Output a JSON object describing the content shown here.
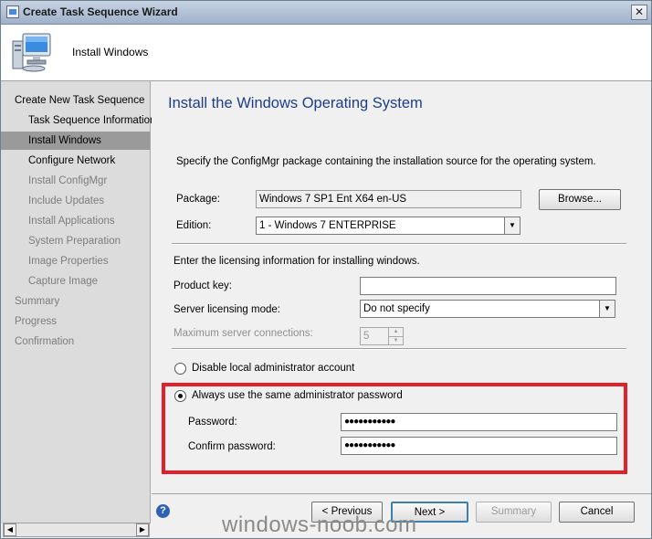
{
  "window": {
    "title": "Create Task Sequence Wizard",
    "close_label": "✕"
  },
  "header": {
    "title": "Install Windows",
    "icon": "computer-icon"
  },
  "nav": {
    "items": [
      {
        "label": "Create New Task Sequence",
        "state": "normal"
      },
      {
        "label": "Task Sequence Information",
        "state": "normal"
      },
      {
        "label": "Install Windows",
        "state": "active"
      },
      {
        "label": "Configure Network",
        "state": "normal"
      },
      {
        "label": "Install ConfigMgr",
        "state": "disabled"
      },
      {
        "label": "Include Updates",
        "state": "disabled"
      },
      {
        "label": "Install Applications",
        "state": "disabled"
      },
      {
        "label": "System Preparation",
        "state": "disabled"
      },
      {
        "label": "Image Properties",
        "state": "disabled"
      },
      {
        "label": "Capture Image",
        "state": "disabled"
      },
      {
        "label": "Summary",
        "state": "disabled"
      },
      {
        "label": "Progress",
        "state": "disabled"
      },
      {
        "label": "Confirmation",
        "state": "disabled"
      }
    ]
  },
  "page": {
    "title": "Install the Windows Operating System",
    "intro": "Specify the ConfigMgr package containing the installation source for the operating system.",
    "package_label": "Package:",
    "package_value": "Windows 7 SP1 Ent X64 en-US",
    "browse_label": "Browse...",
    "edition_label": "Edition:",
    "edition_value": "1 - Windows 7 ENTERPRISE",
    "licensing_text": "Enter the licensing information for installing windows.",
    "product_key_label": "Product key:",
    "product_key_value": "",
    "server_licensing_label": "Server licensing mode:",
    "server_licensing_value": "Do not specify",
    "max_conn_label": "Maximum server connections:",
    "max_conn_value": "5",
    "disable_admin_label": "Disable local administrator account",
    "same_password_label": "Always use the same administrator password",
    "password_label": "Password:",
    "password_value": "●●●●●●●●●●●",
    "confirm_label": "Confirm password:",
    "confirm_value": "●●●●●●●●●●●"
  },
  "footer": {
    "previous": "< Previous",
    "next": "Next >",
    "summary": "Summary",
    "cancel": "Cancel"
  },
  "watermark": "windows-noob.com",
  "colors": {
    "highlight_box": "#e0202a",
    "page_title": "#1c3e8a",
    "nav_active": "#9a9a9a"
  }
}
